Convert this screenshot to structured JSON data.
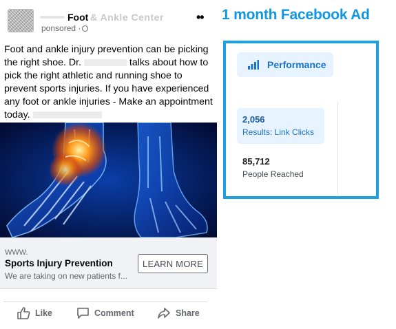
{
  "post": {
    "page_name": "Foot",
    "page_name_tail": "& Ankle Center",
    "sponsored": "ponsored ·",
    "more": "••",
    "text_part1": "Foot and ankle injury prevention can be picking the right shoe. Dr.",
    "text_part2": "talks about how to pick the right athletic and running shoe to prevent sports injuries. If you have experienced any foot or ankle injuries - Make an appointment today.",
    "link": {
      "url": "WWW.",
      "title": "Sports Injury Prevention",
      "description": "We are taking on new patients f...",
      "cta": "LEARN MORE"
    },
    "actions": {
      "like": "Like",
      "comment": "Comment",
      "share": "Share"
    }
  },
  "ad_panel": {
    "title": "1 month Facebook Ad",
    "tab_label": "Performance",
    "metrics": [
      {
        "value": "2,056",
        "label": "Results: Link Clicks"
      },
      {
        "value": "85,712",
        "label": "People Reached"
      }
    ],
    "colors": {
      "accent": "#1ba1e2",
      "tab_bg": "#e7f3ff",
      "link_blue": "#1a73c9"
    }
  }
}
